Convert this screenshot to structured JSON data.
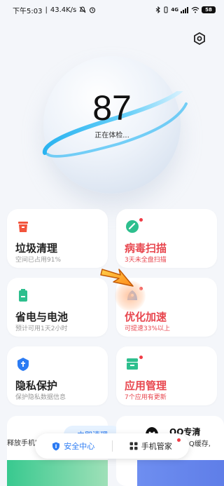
{
  "status_bar": {
    "time": "下午5:03",
    "speed": "43.4K/s",
    "network": "4G",
    "battery": "58"
  },
  "score": {
    "value": "87",
    "status": "正在体检..."
  },
  "cards": [
    {
      "title": "垃圾清理",
      "sub": "空间已占用91%",
      "icon": "trash-icon",
      "warn": false,
      "dot": false
    },
    {
      "title": "病毒扫描",
      "sub": "3天未全盘扫描",
      "icon": "scan-icon",
      "warn": true,
      "dot": true
    },
    {
      "title": "省电与电池",
      "sub": "预计可用1天2小时",
      "icon": "battery-icon",
      "warn": false,
      "dot": false
    },
    {
      "title": "优化加速",
      "sub": "可提速33%以上",
      "icon": "rocket-icon",
      "warn": true,
      "dot": true
    },
    {
      "title": "隐私保护",
      "sub": "保护隐私数据信息",
      "icon": "privacy-icon",
      "warn": false,
      "dot": false
    },
    {
      "title": "应用管理",
      "sub": "7个应用有更新",
      "icon": "app-manage-icon",
      "warn": true,
      "dot": true
    }
  ],
  "promo": {
    "left_text": "释放手机空间",
    "clean_button": "立即清理",
    "qq_title": "QQ专清",
    "qq_sub": "清理QQ缓存,"
  },
  "nav": {
    "security": "安全中心",
    "manager": "手机管家"
  },
  "colors": {
    "accent": "#2b7bf3",
    "warn": "#e8474f",
    "green": "#2ebf8e"
  }
}
